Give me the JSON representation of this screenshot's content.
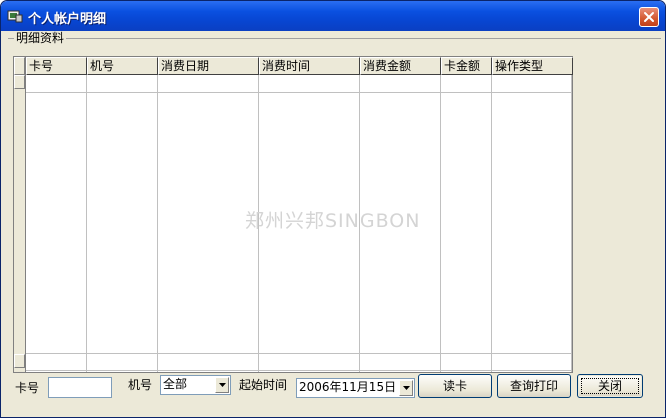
{
  "window": {
    "title": "个人帐户明细",
    "close_icon": "close-icon",
    "app_icon": "app-icon"
  },
  "group": {
    "label": "明细资料"
  },
  "grid": {
    "columns": [
      "卡号",
      "机号",
      "消费日期",
      "消费时间",
      "消费金额",
      "卡金额",
      "操作类型"
    ],
    "rows": []
  },
  "watermark": "郑州兴邦SINGBON",
  "filters": {
    "card_label": "卡号",
    "card_value": "",
    "machine_label": "机号",
    "machine_selected": "全部",
    "start_time_label": "起始时间",
    "start_date_selected": "2006年11月15日"
  },
  "buttons": {
    "read_card": "读卡",
    "query_print": "查询打印",
    "close": "关闭"
  }
}
